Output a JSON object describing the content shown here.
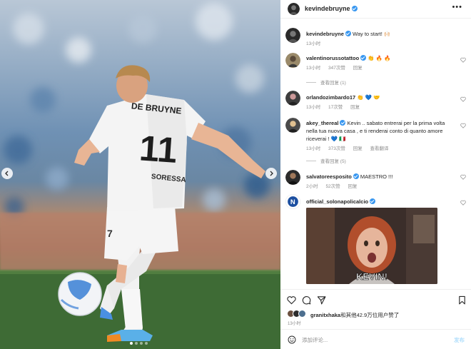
{
  "media": {
    "jersey_name": "DE BRUYNE",
    "jersey_number": "11",
    "sponsor": "SORESSA"
  },
  "header": {
    "username": "kevindebruyne",
    "more_icon": "more-horizontal-icon"
  },
  "caption": {
    "username": "kevindebruyne",
    "text": "Way to start! 🙌🏻",
    "time": "13小时"
  },
  "comments": [
    {
      "username": "valentinorussotattoo",
      "text": "👏 🔥 🔥",
      "time": "13小时",
      "likes": "347次赞",
      "reply": "回复",
      "view_replies": "查看回复 (1)"
    },
    {
      "username": "orlandozimbardo17",
      "text": "👏 💙 🤝",
      "time": "13小时",
      "likes": "17次赞",
      "reply": "回复"
    },
    {
      "username": "akey_thereal",
      "text": "Kevin .. sabato entrerai per la prima volta nella tua nuova casa , e ti renderai conto di quanto amore riceverai ! 💙 🇮🇹",
      "time": "13小时",
      "likes": "373次赞",
      "reply": "回复",
      "translate": "查看翻译",
      "view_replies": "查看回复 (5)"
    },
    {
      "username": "salvatoreesposito",
      "text": "MAESTRO !!!",
      "time": "2小时",
      "likes": "52次赞",
      "reply": "回复"
    },
    {
      "username": "official_solonapolicalcio",
      "text": "",
      "gif_caption": "KEVIN!"
    }
  ],
  "likes_line": {
    "user": "granitxhaka",
    "rest": "和其他42.9万位用户赞了"
  },
  "post_time": "13小时",
  "composer": {
    "placeholder": "添加评论...",
    "post_label": "发布"
  },
  "colors": {
    "verified_blue": "#3897f0",
    "post_button": "#b2dffc",
    "muted_text": "#8e8e8e"
  }
}
